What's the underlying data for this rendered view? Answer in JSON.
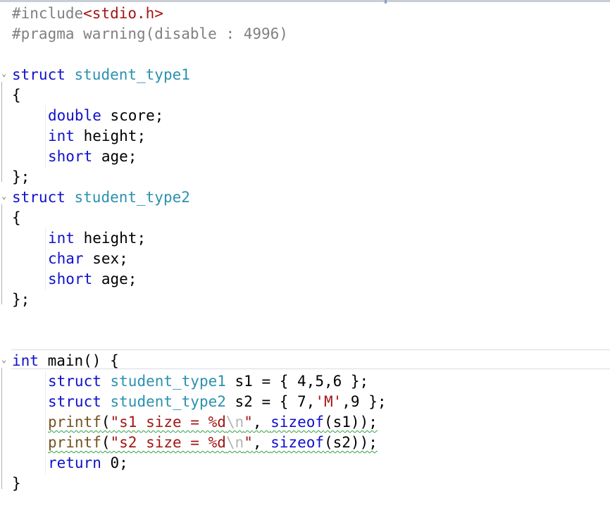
{
  "editor": {
    "language": "C",
    "lines": {
      "include": {
        "directive": "#include",
        "header": "<stdio.h>"
      },
      "pragma": {
        "directive": "#pragma",
        "rest": " warning(disable : 4996)"
      },
      "struct1_decl": {
        "kw": "struct",
        "name": "student_type1"
      },
      "struct1_open": "{",
      "struct1_f1": {
        "type": "double",
        "name": " score;"
      },
      "struct1_f2": {
        "type": "int",
        "name": " height;"
      },
      "struct1_f3": {
        "type": "short",
        "name": " age;"
      },
      "struct1_close": "};",
      "struct2_decl": {
        "kw": "struct",
        "name": "student_type2"
      },
      "struct2_open": "{",
      "struct2_f1": {
        "type": "int",
        "name": " height;"
      },
      "struct2_f2": {
        "type": "char",
        "name": " sex;"
      },
      "struct2_f3": {
        "type": "short",
        "name": " age;"
      },
      "struct2_close": "};",
      "main_decl": {
        "type": "int",
        "rest": " main() {"
      },
      "main_l1": {
        "kw": "struct",
        "type": "student_type1",
        "rest": " s1 = { 4,5,6 };"
      },
      "main_l2": {
        "kw": "struct",
        "type": "student_type2",
        "rest_pre": " s2 = { 7,",
        "char_lit": "'M'",
        "rest_post": ",9 };"
      },
      "main_l3": {
        "fn": "printf",
        "open": "(",
        "str_a": "\"s1 size = %d",
        "esc": "\\n",
        "str_b": "\"",
        "mid": ", ",
        "kw": "sizeof",
        "tail": "(s1));"
      },
      "main_l4": {
        "fn": "printf",
        "open": "(",
        "str_a": "\"s2 size = %d",
        "esc": "\\n",
        "str_b": "\"",
        "mid": ", ",
        "kw": "sizeof",
        "tail": "(s2));"
      },
      "main_l5": {
        "kw": "return",
        "rest": " 0;"
      },
      "main_close": "}"
    },
    "colors": {
      "keyword": "#1010cc",
      "type": "#2b91af",
      "preprocessor": "#808080",
      "string": "#a31515",
      "function": "#74531f",
      "squiggle": "#2ea043"
    }
  }
}
